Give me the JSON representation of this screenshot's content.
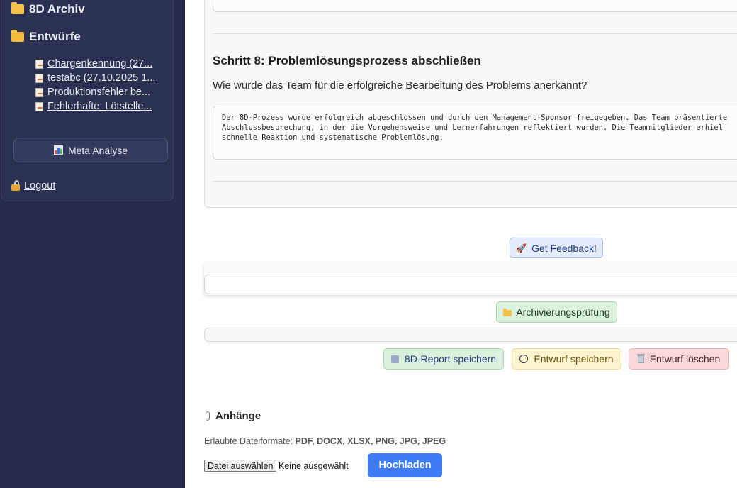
{
  "sidebar": {
    "archive_label": "8D Archiv",
    "drafts_label": "Entwürfe",
    "drafts": [
      {
        "label": "Chargenkennung (27..."
      },
      {
        "label": "testabc (27.10.2025 1..."
      },
      {
        "label": "Produktionsfehler be..."
      },
      {
        "label": "Fehlerhafte_Lötstelle..."
      }
    ],
    "meta_button": "Meta Analyse",
    "logout": "Logout"
  },
  "step": {
    "title": "Schritt 8: Problemlösungsprozess abschließen",
    "question": "Wie wurde das Team für die erfolgreiche Bearbeitung des Problems anerkannt?",
    "answer": "Der 8D-Prozess wurde erfolgreich abgeschlossen und durch den Management-Sponsor freigegeben. Das Team präsentierte\nAbschlussbesprechung, in der die Vorgehensweise und Lernerfahrungen reflektiert wurden. Die Teammitglieder erhiel\nschnelle Reaktion und systematische Problemlösung."
  },
  "feedback": {
    "button": "Get Feedback!"
  },
  "archive_check": {
    "button": "Archivierungsprüfung"
  },
  "actions": {
    "save_report": "8D-Report speichern",
    "save_draft": "Entwurf speichern",
    "delete_draft": "Entwurf löschen"
  },
  "attachments": {
    "title": "Anhänge",
    "formats_prefix": "Erlaubte Dateiformate:",
    "formats": "PDF, DOCX, XLSX, PNG, JPG, JPEG",
    "file_button": "Datei auswählen",
    "file_status": "Keine ausgewählt",
    "upload_button": "Hochladen"
  },
  "colors": {
    "sidebar_bg": "#252b48",
    "upload_blue": "#3d7cf4"
  }
}
